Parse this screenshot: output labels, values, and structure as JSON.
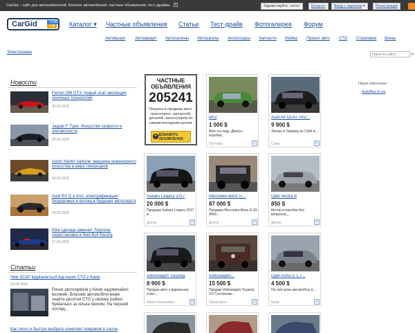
{
  "topbar": {
    "tagline": "CarGid – сайт для автолюбителей. Каталог автомобилей, частные объявления, тест-драйвы",
    "plus": "+",
    "greeting": "Здравствуйте, гость!",
    "notepad": "Блокнот",
    "login": "Вход с паролем",
    "login_arrow": "▾",
    "register": "Регистрация"
  },
  "logo": {
    "text": "CarGid",
    "com": ".COM",
    "ua": ".UA"
  },
  "mainnav": [
    "Каталог ▾",
    "Частные объявления",
    "Статьи",
    "Тест-драйв",
    "Фотогалерея",
    "Форум"
  ],
  "subnav": [
    "Автовыкуп",
    "Автокредит",
    "Автосалоны",
    "Автошколы",
    "Аксессуары",
    "Запчасти",
    "Мойка",
    "Прокат авто",
    "СТО",
    "Страховка",
    "Шины"
  ],
  "subnav_extra": "Электроника",
  "search": {
    "placeholder": "поиск по сайту",
    "go": "↵"
  },
  "news": {
    "title": "Новости",
    "items": [
      {
        "title": "Ferrari 296 GT3: Новый этап эволюции гоночных технологий",
        "date": "30.03.2025"
      },
      {
        "title": "Jaguar F-Type: Искусство скорости и элегантности",
        "date": "30.03.2025"
      },
      {
        "title": "Aston Martin Valkyrie: вершина инженерного искусства в мире гиперкаров",
        "date": "29.03.2025"
      },
      {
        "title": "Audi RS Q e-tron: электрификация бездорожья и взгляд в будущее автоспорта",
        "date": "29.03.2025"
      },
      {
        "title": "Юки Цунода заменит Лоусона: перестановки в Red Bull Racing",
        "date": "27.03.2025"
      }
    ]
  },
  "articles": {
    "title": "Статьи",
    "head_link": "Чим ЗСАР відрізняється від інших СТО у Києві",
    "date": "24.05.2026",
    "text": "Ринок автосервісів у Києві надзвичайно великий. Власник автомобіля може знайти десятки СТО у своєму районі буквально за кілька хвилин. На перший погляд...",
    "foot_link": "Как легко и быстро выбрать комплект ковриков в салон"
  },
  "promo": {
    "heading": "ЧАСТНЫЕ ОБЪЯВЛЕНИЯ",
    "count": "205241",
    "desc": "Покупка и продажа авто-транспорта, запчастей, деталей, аксессуаров по самым выгодным ценам.",
    "button_line1": "ДОБАВИТЬ",
    "button_line2": "ОБЪЯВЛЕНИЕ",
    "button_icon": "+"
  },
  "listings": [
    {
      "name": "ВАЗ",
      "price": "1 000 $",
      "desc": "Авто на ходу. Двигун, коробка...",
      "city": "Полтава",
      "color": "#4a8a3a"
    },
    {
      "name": "Audi A4 QUATTRO...",
      "price": "9 900 $",
      "desc": "Загнан в Украину из США в...",
      "city": "Сумы",
      "color": "#2a2a2a"
    },
    {
      "name": "Subaru Legacy 2017",
      "price": "20 000 $",
      "desc": "Продажа Subaru Legacy 2017 в...",
      "city": "Днепр",
      "color": "#1a1a1a"
    },
    {
      "name": "Mercedes-Benz G...",
      "price": "87 000 $",
      "desc": "Продажа Mercedes-Benz G 63 AMG...",
      "city": "Днепр",
      "color": "#333333"
    },
    {
      "name": "Opel Vectra B",
      "price": "850 $",
      "desc": "Мотор и коробка без вопросов,...",
      "city": "Днепр",
      "color": "#9aa2a8"
    },
    {
      "name": "Volkswagen Touareg",
      "price": "8 900 $",
      "desc": "Продаю авто у відмінному стані....",
      "city": "Ивано-Франковск",
      "color": "#1e1e1e"
    },
    {
      "name": "Volkswagen...",
      "price": "15 500 $",
      "desc": "Продам Volkswagen Touareg 3.0 Состояние...",
      "city": "Запорожье",
      "color": "#4a2a22"
    },
    {
      "name": "Opel Astra G 1.7...",
      "price": "4 500 $",
      "desc": "На свої роки автомобіль в...",
      "city": "Киев",
      "color": "#7a8088"
    },
    {
      "name": "",
      "price": "",
      "desc": "",
      "city": "",
      "color": "#444"
    },
    {
      "name": "",
      "price": "",
      "desc": "",
      "city": "",
      "color": "#8a2a2a"
    },
    {
      "name": "",
      "price": "",
      "desc": "",
      "city": "",
      "color": "#3a4a6a"
    }
  ],
  "partners": {
    "label": "Наша партнеры:",
    "link": "AutoBox.in.ua"
  },
  "star_icon": "☆"
}
